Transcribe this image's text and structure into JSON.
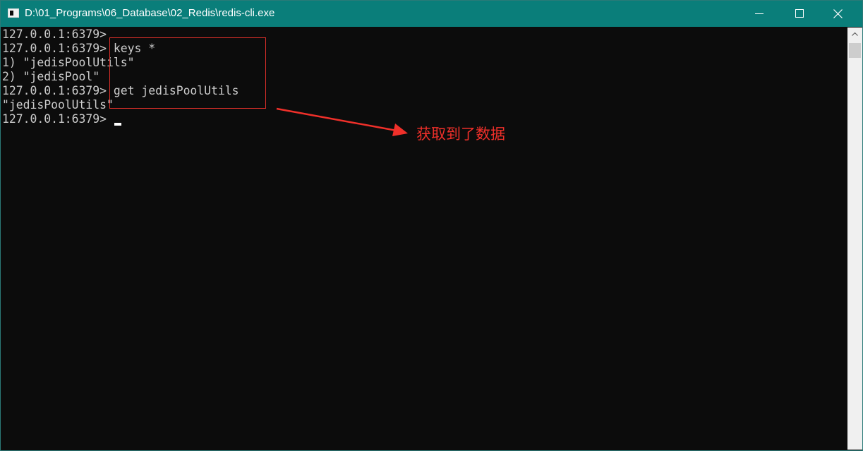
{
  "window": {
    "title": "D:\\01_Programs\\06_Database\\02_Redis\\redis-cli.exe"
  },
  "console": {
    "lines": [
      "127.0.0.1:6379>",
      "127.0.0.1:6379> keys *",
      "1) \"jedisPoolUtils\"",
      "2) \"jedisPool\"",
      "127.0.0.1:6379> get jedisPoolUtils",
      "\"jedisPoolUtils\"",
      "127.0.0.1:6379>"
    ]
  },
  "annotation": {
    "text": "获取到了数据",
    "color": "#f0302a"
  },
  "colors": {
    "titlebar": "#0a7e7a",
    "console_bg": "#0c0c0c",
    "console_text": "#cccccc",
    "highlight": "#e0302a"
  },
  "icons": {
    "app": "console-app-icon",
    "minimize": "minimize-icon",
    "maximize": "maximize-icon",
    "close": "close-icon",
    "scroll_up": "chevron-up-icon"
  }
}
